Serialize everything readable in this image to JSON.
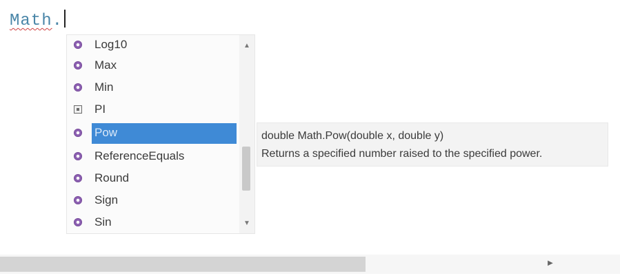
{
  "editor": {
    "code_identifier": "Math",
    "code_dot": "."
  },
  "completion": {
    "items": [
      {
        "label": "Log10",
        "icon": "method-icon"
      },
      {
        "label": "Max",
        "icon": "method-icon"
      },
      {
        "label": "Min",
        "icon": "method-icon"
      },
      {
        "label": "PI",
        "icon": "field-icon"
      },
      {
        "label": "Pow",
        "icon": "method-icon"
      },
      {
        "label": "ReferenceEquals",
        "icon": "method-icon"
      },
      {
        "label": "Round",
        "icon": "method-icon"
      },
      {
        "label": "Sign",
        "icon": "method-icon"
      },
      {
        "label": "Sin",
        "icon": "method-icon"
      }
    ],
    "selected_label": "Pow"
  },
  "tooltip": {
    "signature": "double Math.Pow(double x, double y)",
    "description": "Returns a specified number raised to the specified power."
  },
  "icons": {
    "scroll_up": "scroll-up-arrow-icon",
    "scroll_down": "scroll-down-arrow-icon",
    "scroll_right": "scroll-right-arrow-icon"
  },
  "colors": {
    "selection": "#3f8ad6",
    "code_text": "#4a86a8",
    "method_icon": "#7a4ea0"
  }
}
